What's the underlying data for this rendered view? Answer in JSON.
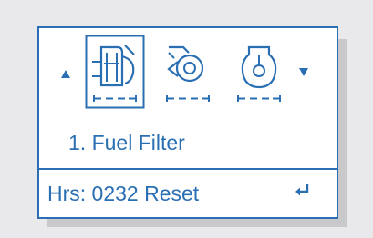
{
  "colors": {
    "accent": "#2a6fb3",
    "screen_bg": "#ffffff",
    "page_bg": "#e9e9eb"
  },
  "menu": {
    "icons": [
      {
        "name": "fuel-filter-icon",
        "selected": true
      },
      {
        "name": "oil-filter-icon",
        "selected": false
      },
      {
        "name": "air-filter-icon",
        "selected": false
      }
    ],
    "up_arrow": "up-arrow-icon",
    "down_arrow": "down-arrow-icon"
  },
  "selected_item": {
    "label": "1. Fuel Filter"
  },
  "status": {
    "hours_text": "Hrs: 0232 Reset",
    "enter_icon": "enter-icon"
  }
}
